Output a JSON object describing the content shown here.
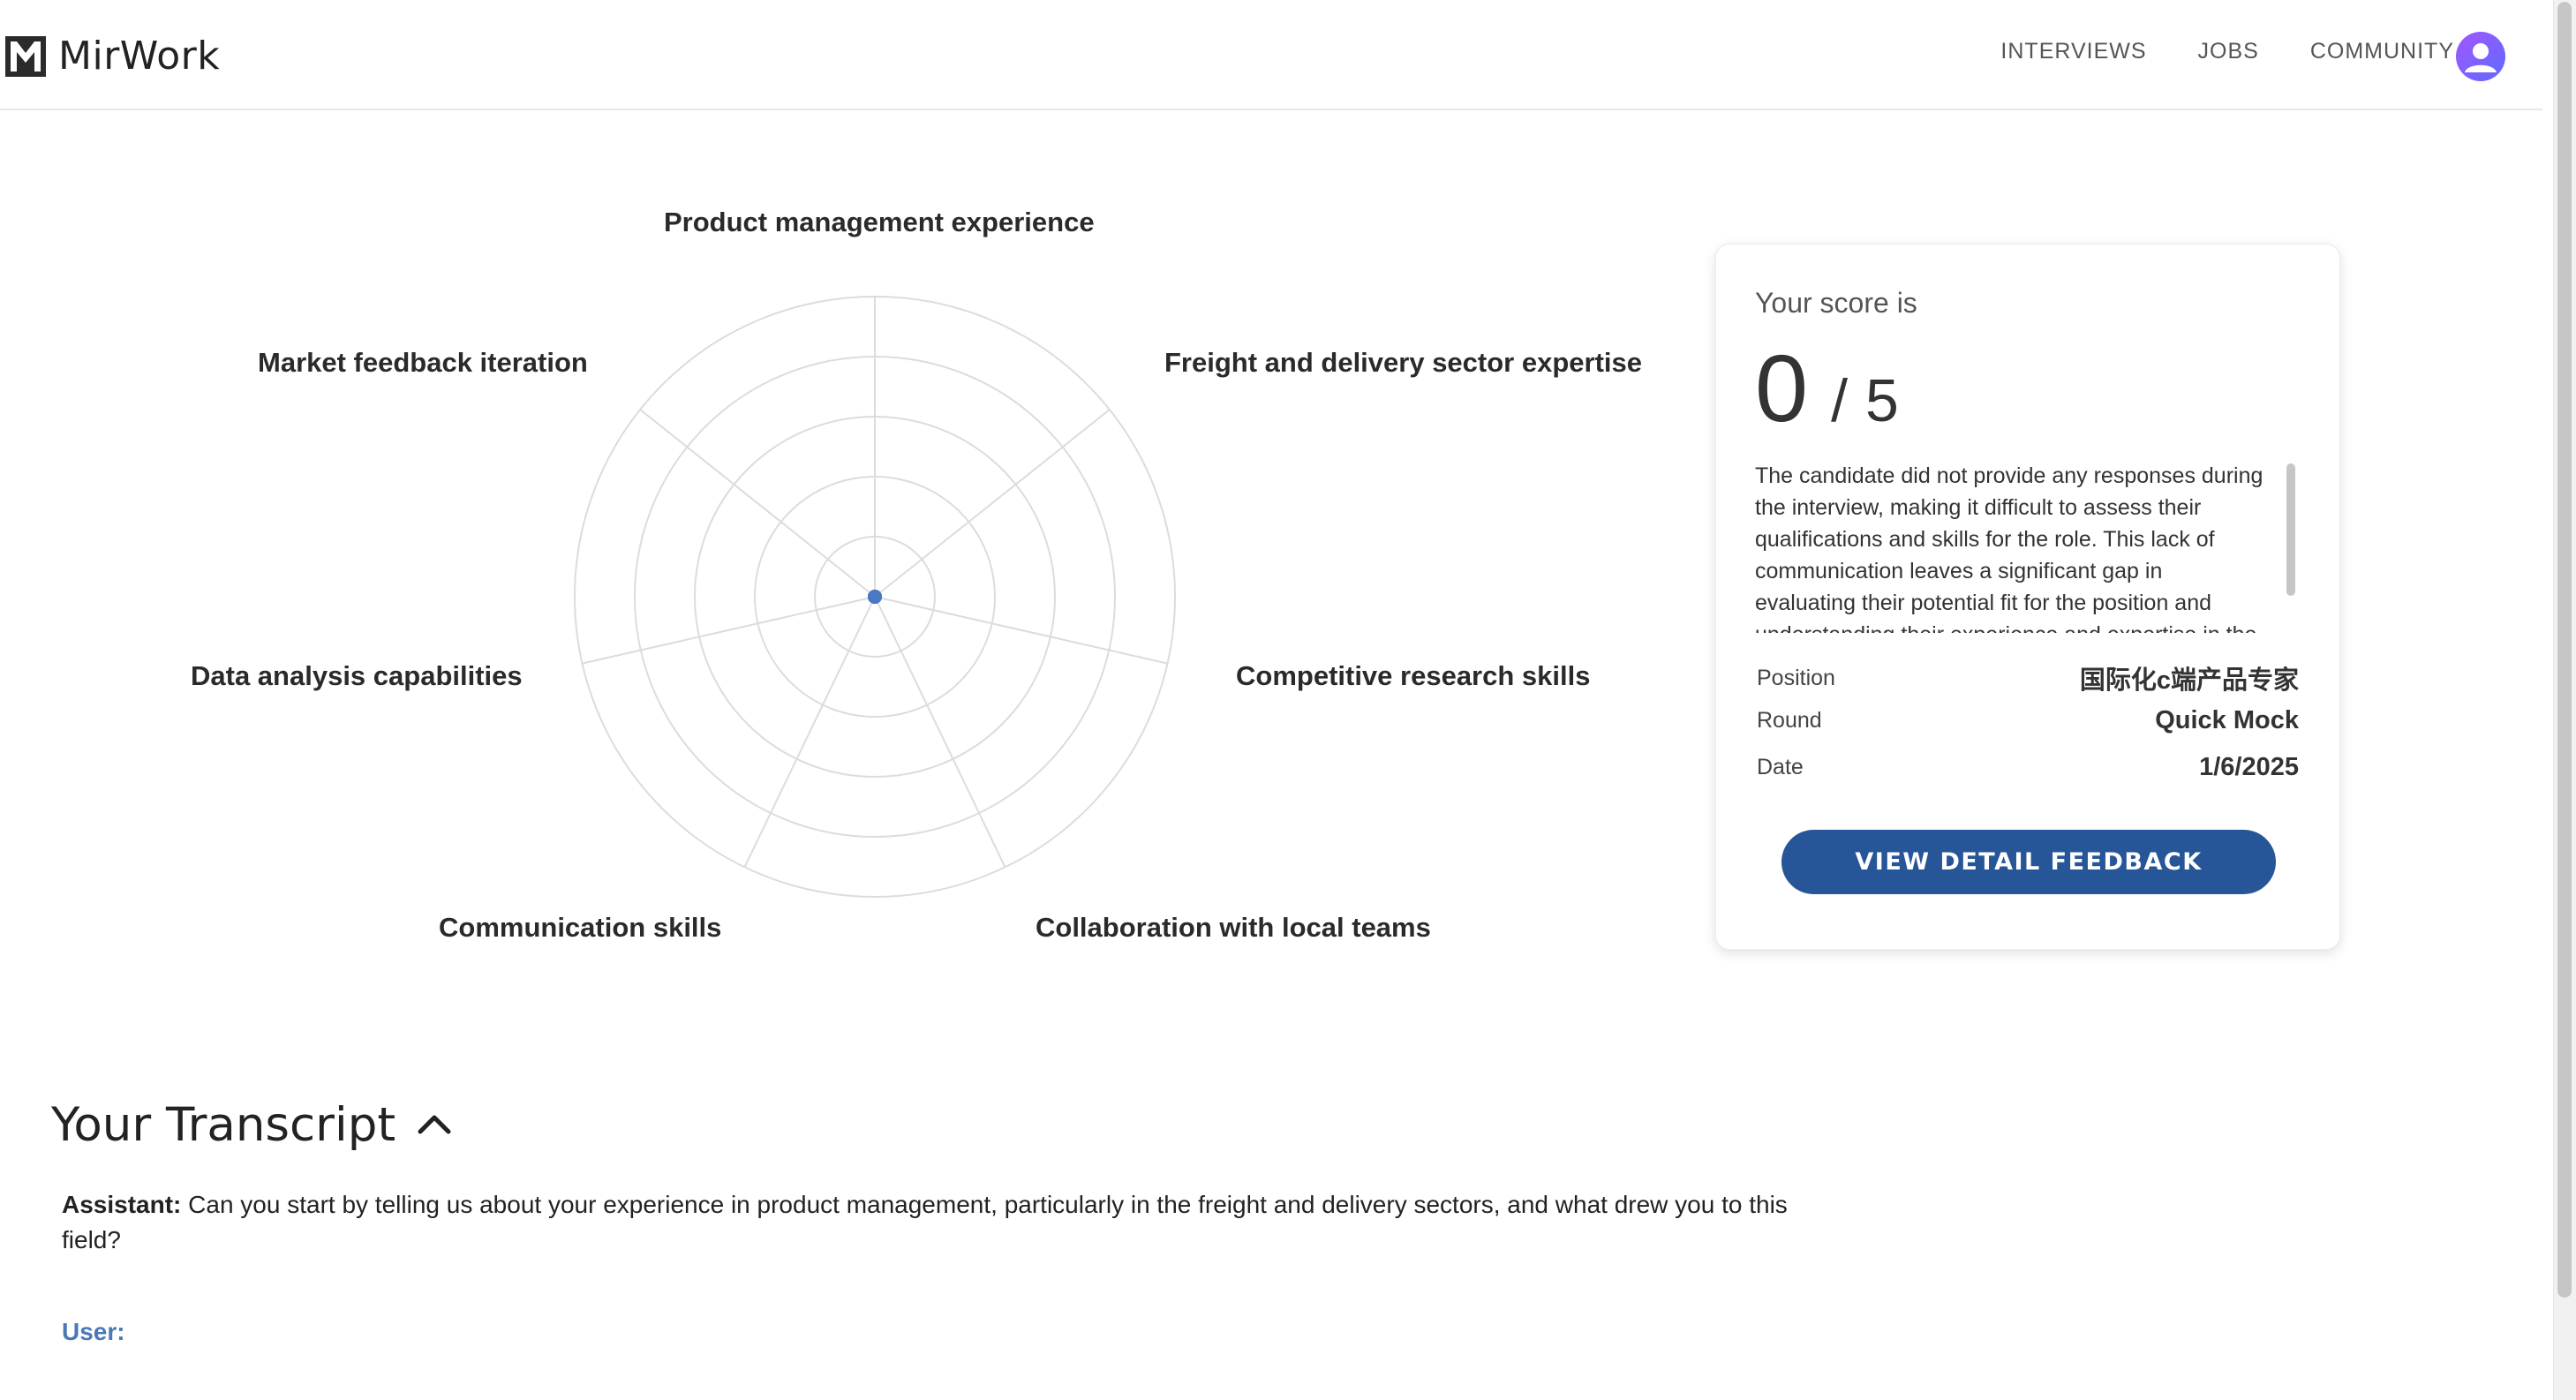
{
  "header": {
    "brand": "MirWork",
    "nav": [
      "INTERVIEWS",
      "JOBS",
      "COMMUNITY"
    ]
  },
  "radar": {
    "axes": [
      "Product management experience",
      "Freight and delivery sector expertise",
      "Competitive research skills",
      "Collaboration with local teams",
      "Communication skills",
      "Data analysis capabilities",
      "Market feedback iteration"
    ],
    "values": [
      0,
      0,
      0,
      0,
      0,
      0,
      0
    ],
    "max": 5,
    "rings": 5
  },
  "score": {
    "caption": "Your score is",
    "value": "0",
    "slash": "/",
    "max": "5",
    "summary": "The candidate did not provide any responses during the interview, making it difficult to assess their qualifications and skills for the role. This lack of communication leaves a significant gap in evaluating their potential fit for the position and understanding their experience and expertise in the",
    "meta": [
      {
        "key": "Position",
        "value": "国际化c端产品专家"
      },
      {
        "key": "Round",
        "value": "Quick Mock"
      },
      {
        "key": "Date",
        "value": "1/6/2025"
      }
    ],
    "button": "VIEW DETAIL FEEDBACK"
  },
  "transcript": {
    "title": "Your Transcript",
    "messages": [
      {
        "speaker": "Assistant:",
        "text": "Can you start by telling us about your experience in product management, particularly in the freight and delivery sectors, and what drew you to this field?"
      },
      {
        "speaker": "User:",
        "text": ""
      }
    ]
  },
  "colors": {
    "accent": "#275698",
    "user_label": "#4a78b8",
    "radar_point": "#4a78c4"
  }
}
